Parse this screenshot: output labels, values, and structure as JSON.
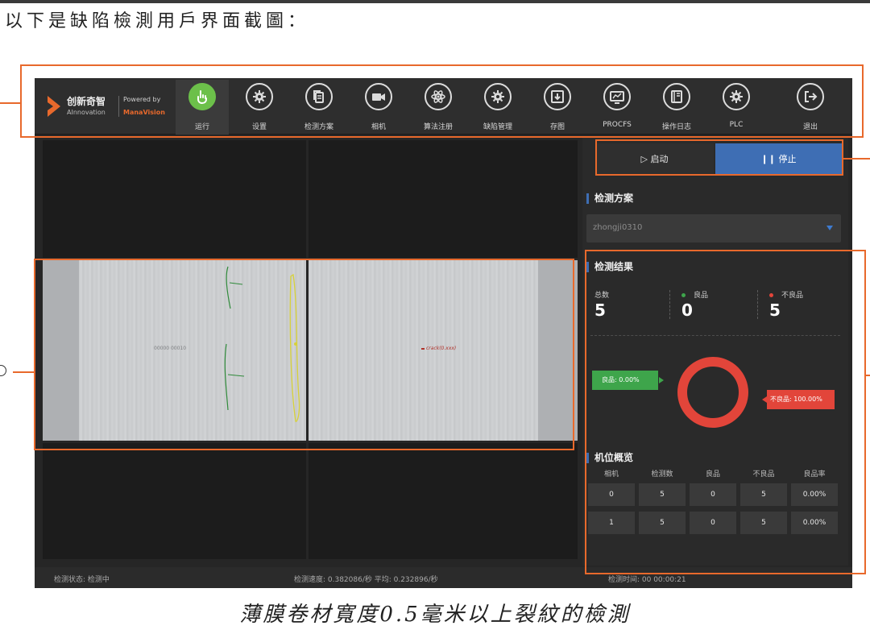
{
  "document": {
    "heading": "以下是缺陷檢測用戶界面截圖：",
    "caption": "薄膜卷材寬度0.5毫米以上裂紋的檢測"
  },
  "app": {
    "brand": {
      "name_cn": "创新奇智",
      "name_en": "AInnovation",
      "powered_by": "Powered by",
      "partner": "ManaVision"
    },
    "toolbar": [
      {
        "label": "运行",
        "icon": "hand-pointer-icon",
        "active": true
      },
      {
        "label": "设置",
        "icon": "gear-icon"
      },
      {
        "label": "检测方案",
        "icon": "document-stack-icon"
      },
      {
        "label": "相机",
        "icon": "video-camera-icon"
      },
      {
        "label": "算法注册",
        "icon": "atom-icon"
      },
      {
        "label": "缺陷管理",
        "icon": "gear-icon"
      },
      {
        "label": "存图",
        "icon": "download-icon"
      },
      {
        "label": "PROCFS",
        "icon": "monitor-chart-icon"
      },
      {
        "label": "操作日志",
        "icon": "book-icon"
      },
      {
        "label": "PLC",
        "icon": "gear-icon"
      },
      {
        "label": "退出",
        "icon": "logout-icon"
      }
    ],
    "controls": {
      "start_label": "启动",
      "stop_label": "停止"
    },
    "scheme": {
      "title": "检测方案",
      "selected": "zhongji0310"
    },
    "results": {
      "title": "检测结果",
      "total_label": "总数",
      "total": "5",
      "good_label": "良品",
      "good": "0",
      "bad_label": "不良品",
      "bad": "5",
      "good_tag": "良品: 0.00%",
      "bad_tag": "不良品: 100.00%",
      "good_ratio": 0.0,
      "bad_ratio": 1.0
    },
    "stations": {
      "title": "机位概览",
      "columns": [
        "相机",
        "检测数",
        "良品",
        "不良品",
        "良品率"
      ],
      "rows": [
        [
          "0",
          "5",
          "0",
          "5",
          "0.00%"
        ],
        [
          "1",
          "5",
          "0",
          "5",
          "0.00%"
        ]
      ]
    },
    "camera_view": {
      "left_barcode": "00000 00010",
      "right_defect_label": "crack(0.xxx)"
    },
    "status": {
      "state": "检测状态: 检测中",
      "speed": "检测速度: 0.382086/秒 平均: 0.232896/秒",
      "time": "检测时间: 00 00:00:21"
    }
  },
  "colors": {
    "accent_blue": "#3e6eb4",
    "good_green": "#3ea54b",
    "bad_red": "#e2453a",
    "annotation_orange": "#e8692c",
    "active_green": "#6cc04a"
  }
}
